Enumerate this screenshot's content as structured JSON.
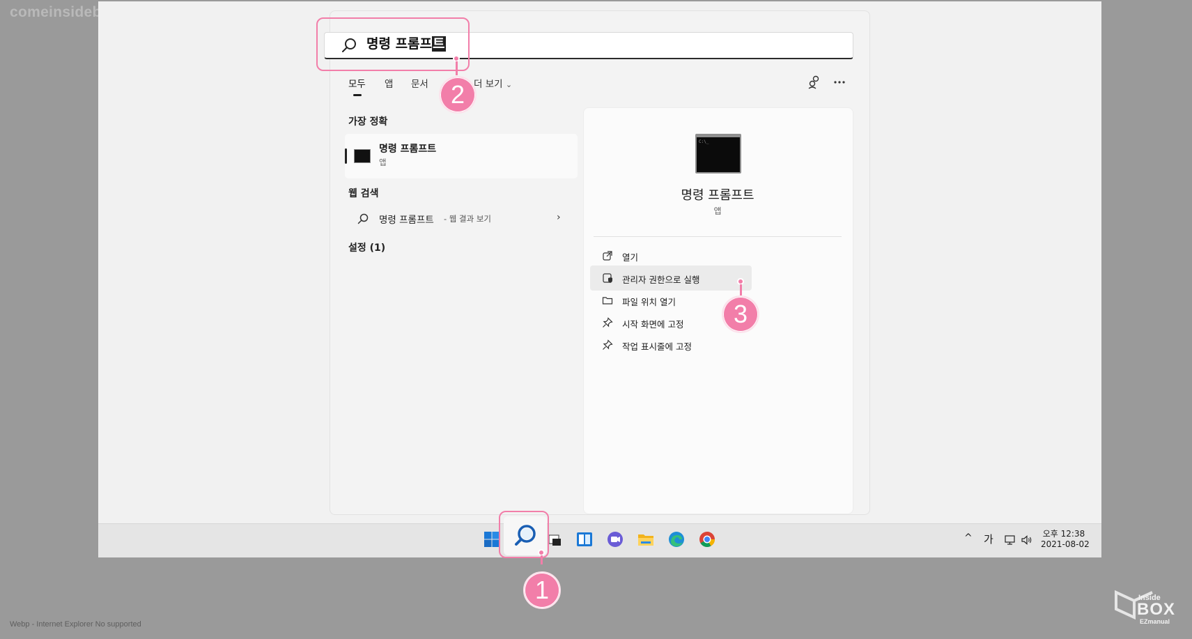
{
  "watermark": {
    "site": "comeinsidebox.com",
    "bottom_note": "Webp - Internet Explorer No supported",
    "logo_text_top": "Inside",
    "logo_text_box": "BOX",
    "logo_text_sub": "EZmanual"
  },
  "search": {
    "text_main": "명령 프롬프",
    "text_last_char": "트"
  },
  "tabs": {
    "all": "모두",
    "apps": "앱",
    "documents": "문서",
    "more": "더 보기",
    "more_caret": "⌄"
  },
  "results": {
    "best_match_header": "가장 정확",
    "best_match": {
      "title": "명령 프롬프트",
      "subtitle": "앱"
    },
    "web_header": "웹 검색",
    "web_item": {
      "title": "명령 프롬프트",
      "subtitle": "- 웹 결과 보기",
      "chevron": "›"
    },
    "settings_header": "설정 (1)"
  },
  "detail": {
    "title": "명령 프롬프트",
    "subtitle": "앱",
    "actions": [
      "열기",
      "관리자 권한으로 실행",
      "파일 위치 열기",
      "시작 화면에 고정",
      "작업 표시줄에 고정"
    ]
  },
  "callouts": {
    "one": "1",
    "two": "2",
    "three": "3"
  },
  "taskbar": {
    "tray_chevron": "^",
    "ime": "가",
    "clock_time": "오후 12:38",
    "clock_date": "2021-08-02"
  },
  "icons": {
    "search": "search-icon",
    "start": "windows-logo-icon",
    "accent": "#f27ea9"
  }
}
